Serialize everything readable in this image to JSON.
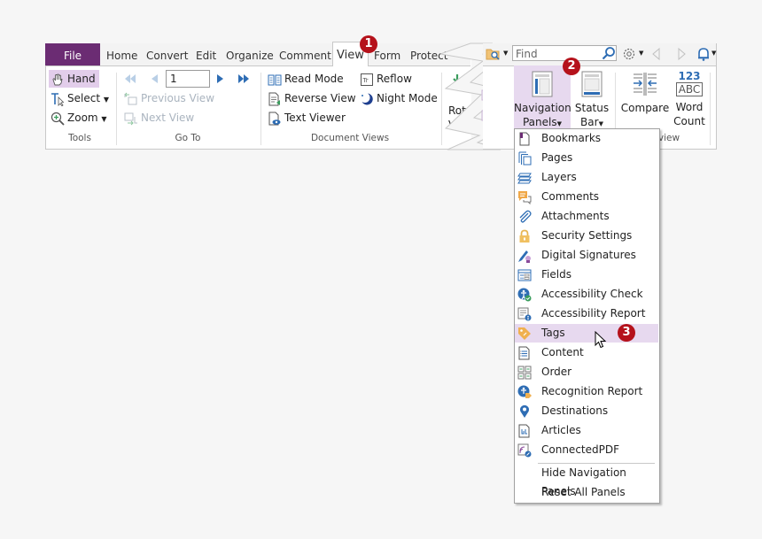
{
  "tabs": {
    "file": "File",
    "items": [
      "Home",
      "Convert",
      "Edit",
      "Organize",
      "Comment",
      "View",
      "Form",
      "Protect"
    ],
    "active": "View"
  },
  "tools_group": {
    "label": "Tools",
    "hand": "Hand",
    "select": "Select",
    "zoom": "Zoom"
  },
  "goto_group": {
    "label": "Go To",
    "page_value": "1",
    "previous_view": "Previous View",
    "next_view": "Next View"
  },
  "docviews_group": {
    "label": "Document Views",
    "read_mode": "Read Mode",
    "reverse_view": "Reverse View",
    "text_viewer": "Text Viewer",
    "reflow": "Reflow",
    "night_mode": "Night Mode"
  },
  "rotate_partial": "Rota\nVi",
  "find": {
    "placeholder": "Find"
  },
  "right_group": {
    "navigation_panels_line1": "Navigation",
    "navigation_panels_line2": "Panels",
    "status_bar_line1": "Status",
    "status_bar_line2": "Bar",
    "compare": "Compare",
    "word_count_line1": "Word",
    "word_count_line2": "Count",
    "word_count_icon_top": "123",
    "word_count_icon_bottom": "ABC",
    "group_label_partial": "view"
  },
  "badges": [
    "1",
    "2",
    "3"
  ],
  "menu": {
    "items": [
      {
        "label": "Bookmarks",
        "icon": "bookmark-icon"
      },
      {
        "label": "Pages",
        "icon": "pages-icon"
      },
      {
        "label": "Layers",
        "icon": "layers-icon"
      },
      {
        "label": "Comments",
        "icon": "comments-icon"
      },
      {
        "label": "Attachments",
        "icon": "paperclip-icon"
      },
      {
        "label": "Security Settings",
        "icon": "lock-icon"
      },
      {
        "label": "Digital Signatures",
        "icon": "pen-signature-icon"
      },
      {
        "label": "Fields",
        "icon": "fields-icon"
      },
      {
        "label": "Accessibility Check",
        "icon": "accessibility-check-icon"
      },
      {
        "label": "Accessibility Report",
        "icon": "accessibility-report-icon"
      },
      {
        "label": "Tags",
        "icon": "tag-icon"
      },
      {
        "label": "Content",
        "icon": "content-icon"
      },
      {
        "label": "Order",
        "icon": "order-icon"
      },
      {
        "label": "Recognition Report",
        "icon": "recognition-report-icon"
      },
      {
        "label": "Destinations",
        "icon": "map-pin-icon"
      },
      {
        "label": "Articles",
        "icon": "articles-icon"
      },
      {
        "label": "ConnectedPDF",
        "icon": "connectedpdf-icon"
      }
    ],
    "hide": "Hide Navigation Panels",
    "reset": "Reset All Panels",
    "highlighted": "Tags"
  },
  "colors": {
    "file_tab": "#6b2c73",
    "highlight": "#e7d9ef",
    "badge": "#b5121b",
    "accent_blue": "#2e6db4"
  }
}
